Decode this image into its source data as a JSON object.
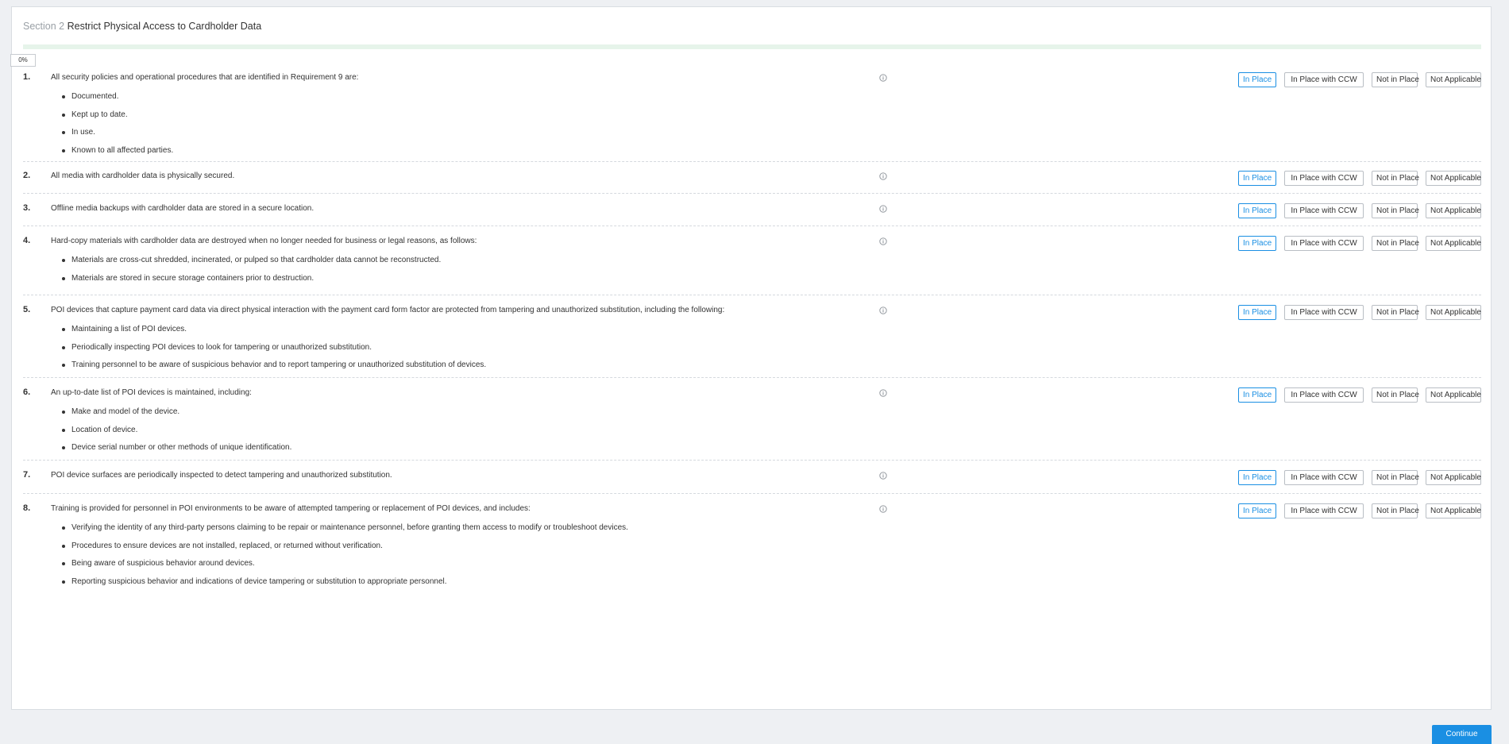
{
  "section": {
    "label": "Section 2",
    "title": "Restrict Physical Access to Cardholder Data"
  },
  "progress": {
    "percent": 0,
    "label": "0%"
  },
  "options": [
    "In Place",
    "In Place with CCW",
    "Not in Place",
    "Not Applicable"
  ],
  "colors": {
    "accent": "#1a8fe3",
    "progress_track": "#e6f4ea",
    "background": "#eef0f3"
  },
  "requirements": [
    {
      "number": "1.",
      "text": "All security policies and operational procedures that are identified in Requirement 9 are:",
      "bullets": [
        "Documented.",
        "Kept up to date.",
        "In use.",
        "Known to all affected parties."
      ],
      "selected": "In Place"
    },
    {
      "number": "2.",
      "text": "All media with cardholder data is physically secured.",
      "bullets": [],
      "selected": "In Place"
    },
    {
      "number": "3.",
      "text": "Offline media backups with cardholder data are stored in a secure location.",
      "bullets": [],
      "selected": "In Place"
    },
    {
      "number": "4.",
      "text": "Hard-copy materials with cardholder data are destroyed when no longer needed for business or legal reasons, as follows:",
      "bullets": [
        "Materials are cross-cut shredded, incinerated, or pulped so that cardholder data cannot be reconstructed.",
        "Materials are stored in secure storage containers prior to destruction."
      ],
      "selected": "In Place"
    },
    {
      "number": "5.",
      "text": "POI devices that capture payment card data via direct physical interaction with the payment card form factor are protected from tampering and unauthorized substitution, including the following:",
      "bullets": [
        "Maintaining a list of POI devices.",
        "Periodically inspecting POI devices to look for tampering or unauthorized substitution.",
        "Training personnel to be aware of suspicious behavior and to report tampering or unauthorized substitution of devices."
      ],
      "selected": "In Place"
    },
    {
      "number": "6.",
      "text": "An up-to-date list of POI devices is maintained, including:",
      "bullets": [
        "Make and model of the device.",
        "Location of device.",
        "Device serial number or other methods of unique identification."
      ],
      "selected": "In Place"
    },
    {
      "number": "7.",
      "text": "POI device surfaces are periodically inspected to detect tampering and unauthorized substitution.",
      "bullets": [],
      "selected": "In Place"
    },
    {
      "number": "8.",
      "text": "Training is provided for personnel in POI environments to be aware of attempted tampering or replacement of POI devices, and includes:",
      "bullets": [
        "Verifying the identity of any third-party persons claiming to be repair or maintenance personnel, before granting them access to modify or troubleshoot devices.",
        "Procedures to ensure devices are not installed, replaced, or returned without verification.",
        "Being aware of suspicious behavior around devices.",
        "Reporting suspicious behavior and indications of device tampering or substitution to appropriate personnel."
      ],
      "selected": "In Place"
    }
  ],
  "footer": {
    "continue_label": "Continue"
  }
}
